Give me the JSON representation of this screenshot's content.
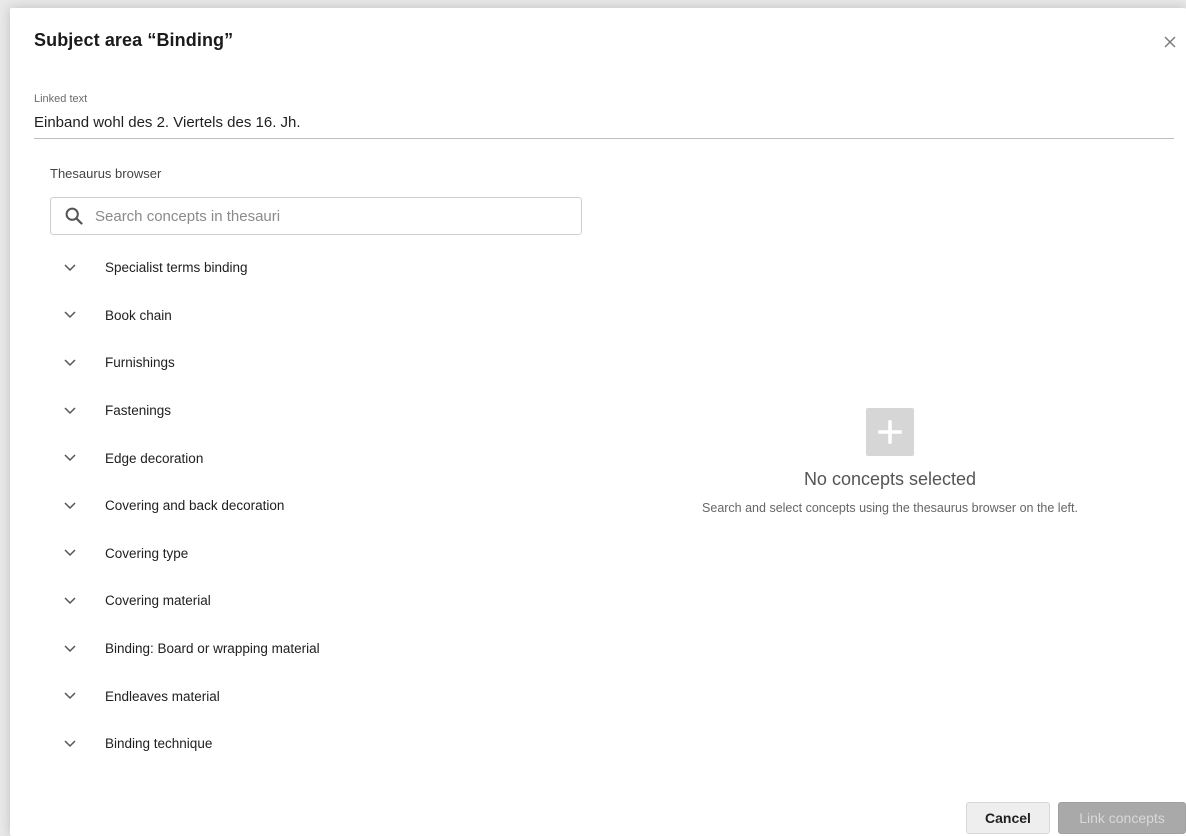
{
  "dialog": {
    "title": "Subject area “Binding”",
    "linked_text_label": "Linked text",
    "linked_text_value": "Einband wohl des 2. Viertels des 16. Jh."
  },
  "thesaurus": {
    "label": "Thesaurus browser",
    "search_placeholder": "Search concepts in thesauri",
    "items": [
      {
        "label": "Specialist terms binding"
      },
      {
        "label": "Book chain"
      },
      {
        "label": "Furnishings"
      },
      {
        "label": "Fastenings"
      },
      {
        "label": "Edge decoration"
      },
      {
        "label": "Covering and back decoration"
      },
      {
        "label": "Covering type"
      },
      {
        "label": "Covering material"
      },
      {
        "label": "Binding: Board or wrapping material"
      },
      {
        "label": "Endleaves material"
      },
      {
        "label": "Binding technique"
      }
    ]
  },
  "empty_state": {
    "icon": "plus-icon",
    "title": "No concepts selected",
    "subtitle": "Search and select concepts using the thesaurus browser on the left."
  },
  "footer": {
    "cancel_label": "Cancel",
    "link_label": "Link concepts"
  },
  "colors": {
    "disabled_button": "#a9a9a9",
    "cancel_button": "#eeeeee"
  }
}
